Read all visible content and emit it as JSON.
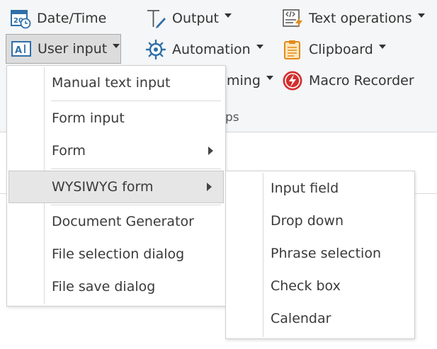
{
  "ribbon": {
    "buttons": {
      "datetime": {
        "label": "Date/Time",
        "icon": "calendar-clock-icon"
      },
      "output": {
        "label": "Output",
        "icon": "pen-icon"
      },
      "textops": {
        "label": "Text operations",
        "icon": "text-code-icon"
      },
      "userinput": {
        "label": "User input",
        "icon": "text-field-icon"
      },
      "automation": {
        "label": "Automation",
        "icon": "gear-icon"
      },
      "clipboard": {
        "label": "Clipboard",
        "icon": "clipboard-icon"
      },
      "programming": {
        "label": "ming",
        "icon": ""
      },
      "macro": {
        "label": "Macro Recorder",
        "icon": "record-icon"
      }
    },
    "group_label": "ps"
  },
  "user_input_menu": {
    "items": [
      {
        "label": "Manual text input"
      },
      {
        "label": "Form input"
      },
      {
        "label": "Form",
        "submenu": true
      },
      {
        "label": "WYSIWYG form",
        "submenu": true,
        "highlighted": true
      },
      {
        "label": "Document Generator"
      },
      {
        "label": "File selection dialog"
      },
      {
        "label": "File save dialog"
      }
    ]
  },
  "wysiwyg_submenu": {
    "items": [
      {
        "label": "Input field"
      },
      {
        "label": "Drop down"
      },
      {
        "label": "Phrase selection"
      },
      {
        "label": "Check box"
      },
      {
        "label": "Calendar"
      }
    ]
  },
  "colors": {
    "icon_blue": "#2f6fa8",
    "clipboard_orange": "#e38b1b",
    "macro_red": "#d32f2f",
    "highlight": "#e6e6e6"
  }
}
